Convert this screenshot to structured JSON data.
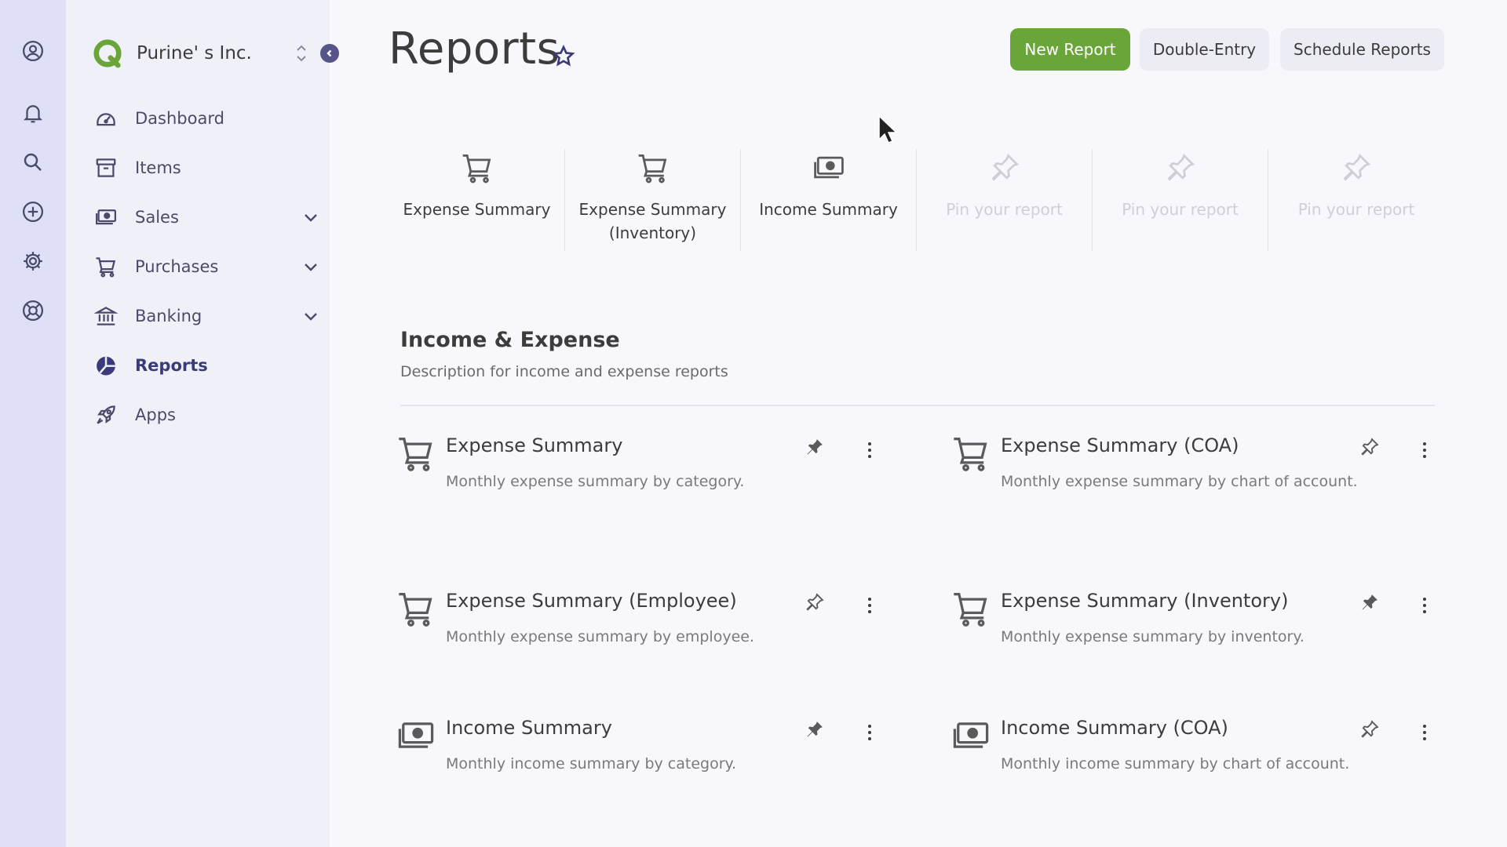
{
  "rail": {
    "icons": [
      "profile-icon",
      "bell-icon",
      "search-icon",
      "plus-circle-icon",
      "gear-icon",
      "support-icon"
    ]
  },
  "sidebar": {
    "company_name": "Purine' s Inc.",
    "items": [
      {
        "label": "Dashboard",
        "icon": "dashboard-icon",
        "expandable": false
      },
      {
        "label": "Items",
        "icon": "archive-icon",
        "expandable": false
      },
      {
        "label": "Sales",
        "icon": "money-icon",
        "expandable": true
      },
      {
        "label": "Purchases",
        "icon": "cart-icon",
        "expandable": true
      },
      {
        "label": "Banking",
        "icon": "bank-icon",
        "expandable": true
      },
      {
        "label": "Reports",
        "icon": "pie-chart-icon",
        "expandable": false,
        "active": true
      },
      {
        "label": "Apps",
        "icon": "rocket-icon",
        "expandable": false
      }
    ]
  },
  "header": {
    "title": "Reports",
    "buttons": {
      "new_report": "New Report",
      "double_entry": "Double-Entry",
      "schedule_reports": "Schedule Reports"
    }
  },
  "pinned": [
    {
      "label": "Expense Summary",
      "icon": "cart-icon"
    },
    {
      "label": "Expense Summary (Inventory)",
      "icon": "cart-icon"
    },
    {
      "label": "Income Summary",
      "icon": "money-icon"
    },
    {
      "label": "Pin your report",
      "icon": "pin-icon",
      "empty": true
    },
    {
      "label": "Pin your report",
      "icon": "pin-icon",
      "empty": true
    },
    {
      "label": "Pin your report",
      "icon": "pin-icon",
      "empty": true
    }
  ],
  "section": {
    "title": "Income & Expense",
    "description": "Description for income and expense reports",
    "reports": [
      {
        "title": "Expense Summary",
        "description": "Monthly expense summary by category.",
        "icon": "cart-icon",
        "pinned": true
      },
      {
        "title": "Expense Summary (COA)",
        "description": "Monthly expense summary by chart of account.",
        "icon": "cart-icon",
        "pinned": false
      },
      {
        "title": "Expense Summary (Employee)",
        "description": "Monthly expense summary by employee.",
        "icon": "cart-icon",
        "pinned": false
      },
      {
        "title": "Expense Summary (Inventory)",
        "description": "Monthly expense summary by inventory.",
        "icon": "cart-icon",
        "pinned": true
      },
      {
        "title": "Income Summary",
        "description": "Monthly income summary by category.",
        "icon": "money-icon",
        "pinned": true
      },
      {
        "title": "Income Summary (COA)",
        "description": "Monthly income summary by chart of account.",
        "icon": "money-icon",
        "pinned": false
      }
    ]
  },
  "colors": {
    "accent_green": "#6aa53a",
    "rail_bg": "#dfe0f8",
    "sidebar_bg": "#f0f0f8",
    "nav_text": "#4a4a6a"
  }
}
